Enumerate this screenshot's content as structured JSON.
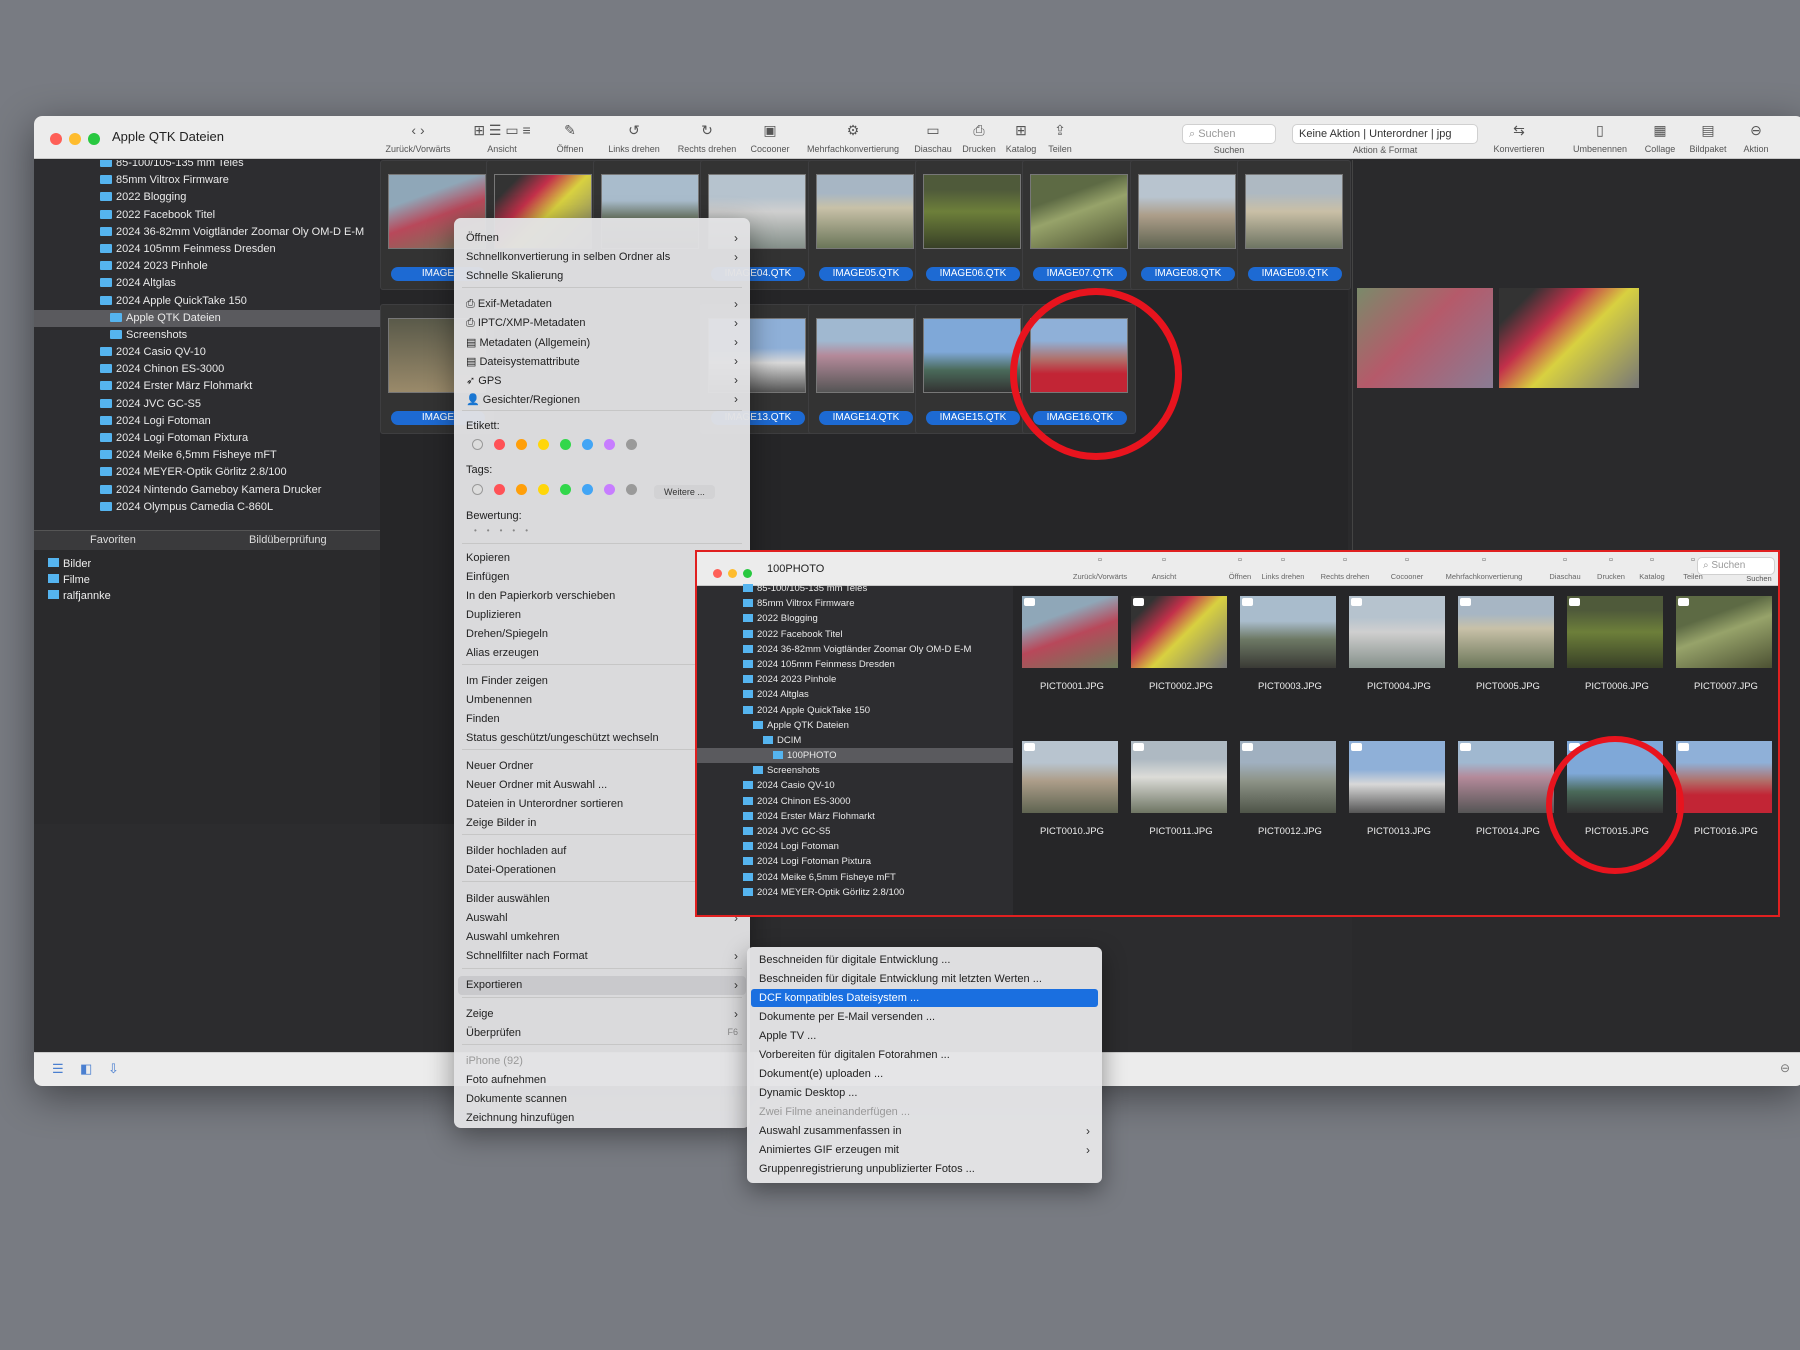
{
  "window": {
    "title": "Apple QTK Dateien",
    "toolbar": {
      "nav_label": "Zurück/Vorwärts",
      "view_label": "Ansicht",
      "open_label": "Öffnen",
      "rotate_left_label": "Links drehen",
      "rotate_right_label": "Rechts drehen",
      "cocooner_label": "Cocooner",
      "batch_label": "Mehrfachkonvertierung",
      "slideshow_label": "Diaschau",
      "print_label": "Drucken",
      "catalog_label": "Katalog",
      "share_label": "Teilen",
      "search_placeholder": "Suchen",
      "search_label": "Suchen",
      "action_dropdown": "Keine Aktion | Unterordner | jpg",
      "action_format_label": "Aktion & Format",
      "convert_label": "Konvertieren",
      "rename_label": "Umbenennen",
      "collage_label": "Collage",
      "package_label": "Bildpaket",
      "action_label": "Aktion"
    }
  },
  "sidebar": {
    "folders": [
      "85-100/105-135 mm Teles",
      "85mm Viltrox Firmware",
      "2022 Blogging",
      "2022 Facebook Titel",
      "2024 36-82mm Voigtländer Zoomar Oly OM-D E-M",
      "2024 105mm Feinmess Dresden",
      "2024 2023 Pinhole",
      "2024 Altglas",
      "2024 Apple QuickTake 150",
      "Apple QTK Dateien",
      "Screenshots",
      "2024 Casio QV-10",
      "2024 Chinon ES-3000",
      "2024 Erster März Flohmarkt",
      "2024 JVC GC-S5",
      "2024 Logi Fotoman",
      "2024 Logi Fotoman Pixtura",
      "2024 Meike 6,5mm Fisheye mFT",
      "2024 MEYER-Optik Görlitz 2.8/100",
      "2024 Nintendo Gameboy Kamera Drucker",
      "2024 Olympus Camedia C-860L"
    ],
    "tabs": [
      "Favoriten",
      "Bildüberprüfung"
    ],
    "favorites": [
      "Bilder",
      "Filme",
      "ralfjannke"
    ]
  },
  "grid": {
    "row1": [
      "IMAGE",
      "",
      "",
      "IMAGE04.QTK",
      "IMAGE05.QTK",
      "IMAGE06.QTK",
      "IMAGE07.QTK",
      "IMAGE08.QTK",
      "IMAGE09.QTK"
    ],
    "row2": [
      "IMAGE",
      "IMAGE13.QTK",
      "IMAGE14.QTK",
      "IMAGE15.QTK",
      "IMAGE16.QTK"
    ]
  },
  "context_menu": {
    "items": [
      "Öffnen",
      "Schnellkonvertierung in selben Ordner als",
      "Schnelle Skalierung",
      "Exif-Metadaten",
      "IPTC/XMP-Metadaten",
      "Metadaten (Allgemein)",
      "Dateisystemattribute",
      "GPS",
      "Gesichter/Regionen",
      "Etikett:",
      "Tags:",
      "Weitere ...",
      "Bewertung:",
      "Kopieren",
      "Einfügen",
      "In den Papierkorb verschieben",
      "Duplizieren",
      "Drehen/Spiegeln",
      "Alias erzeugen",
      "Im Finder zeigen",
      "Umbenennen",
      "Finden",
      "Status geschützt/ungeschützt wechseln",
      "Neuer Ordner",
      "Neuer Ordner mit Auswahl ...",
      "Dateien in Unterordner sortieren",
      "Zeige Bilder in",
      "Bilder hochladen auf",
      "Datei-Operationen",
      "Bilder auswählen",
      "Auswahl",
      "Auswahl umkehren",
      "Schnellfilter nach Format",
      "Exportieren",
      "Zeige",
      "Überprüfen",
      "iPhone (92)",
      "Foto aufnehmen",
      "Dokumente scannen",
      "Zeichnung hinzufügen"
    ],
    "label_colors": [
      "#ff5257",
      "#ff9f0a",
      "#ffd60a",
      "#32d74b",
      "#42a5f5",
      "#c77dff",
      "#9a9a9a"
    ],
    "shortcut_check": "F6"
  },
  "submenu": {
    "items": [
      "Beschneiden für digitale Entwicklung ...",
      "Beschneiden für digitale Entwicklung mit letzten Werten ...",
      "DCF kompatibles Dateisystem ...",
      "Dokumente per E-Mail versenden ...",
      "Apple TV ...",
      "Vorbereiten für digitalen Fotorahmen ...",
      "Dokument(e) uploaden ...",
      "Dynamic Desktop ...",
      "Zwei Filme aneinanderfügen ...",
      "Auswahl zusammenfassen in",
      "Animiertes GIF erzeugen mit",
      "Gruppenregistrierung unpublizierter Fotos ..."
    ]
  },
  "inset": {
    "title": "100PHOTO",
    "toolbar_labels": [
      "Zurück/Vorwärts",
      "Ansicht",
      "Öffnen",
      "Links drehen",
      "Rechts drehen",
      "Cocooner",
      "Mehrfachkonvertierung",
      "Diaschau",
      "Drucken",
      "Katalog",
      "Teilen",
      "Suchen"
    ],
    "search_placeholder": "Suchen",
    "folders": [
      "85-100/105-135 mm Teles",
      "85mm Viltrox Firmware",
      "2022 Blogging",
      "2022 Facebook Titel",
      "2024 36-82mm Voigtländer Zoomar Oly OM-D E-M",
      "2024 105mm Feinmess Dresden",
      "2024 2023 Pinhole",
      "2024 Altglas",
      "2024 Apple QuickTake 150",
      "Apple QTK Dateien",
      "DCIM",
      "100PHOTO",
      "Screenshots",
      "2024 Casio QV-10",
      "2024 Chinon ES-3000",
      "2024 Erster März Flohmarkt",
      "2024 JVC GC-S5",
      "2024 Logi Fotoman",
      "2024 Logi Fotoman Pixtura",
      "2024 Meike 6,5mm Fisheye mFT",
      "2024 MEYER-Optik Görlitz 2.8/100"
    ],
    "files_row1": [
      "PICT0001.JPG",
      "PICT0002.JPG",
      "PICT0003.JPG",
      "PICT0004.JPG",
      "PICT0005.JPG",
      "PICT0006.JPG",
      "PICT0007.JPG"
    ],
    "files_row2": [
      "PICT0010.JPG",
      "PICT0011.JPG",
      "PICT0012.JPG",
      "PICT0013.JPG",
      "PICT0014.JPG",
      "PICT0015.JPG",
      "PICT0016.JPG"
    ]
  },
  "colors": {
    "highlight_circle": "#e8141e",
    "selection_blue": "#1d6ad3",
    "folder_blue": "#55b4ef"
  }
}
